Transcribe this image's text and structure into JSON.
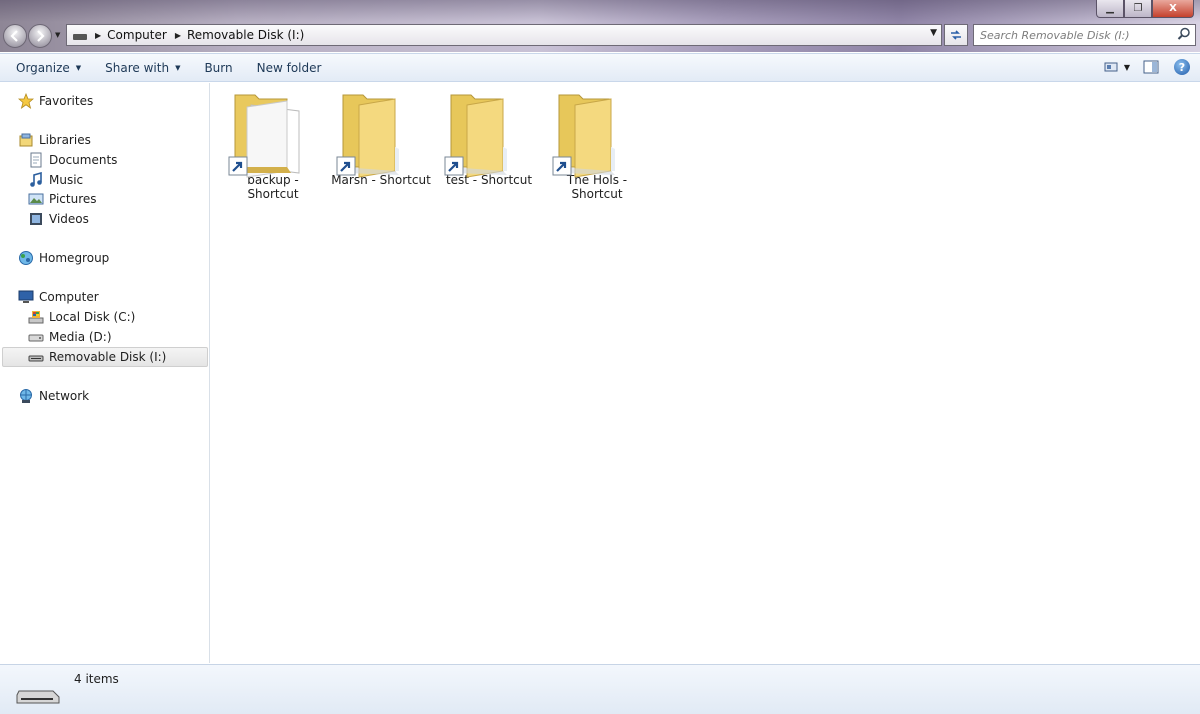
{
  "window": {
    "minimize_glyph": "▁",
    "maximize_glyph": "❐",
    "close_glyph": "X"
  },
  "address_bar": {
    "breadcrumbs": [
      "Computer",
      "Removable Disk (I:)"
    ],
    "search_placeholder": "Search Removable Disk (I:)"
  },
  "toolbar": {
    "organize_label": "Organize",
    "share_label": "Share with",
    "burn_label": "Burn",
    "new_folder_label": "New folder"
  },
  "sidebar": {
    "favorites": "Favorites",
    "libraries": "Libraries",
    "library_items": [
      "Documents",
      "Music",
      "Pictures",
      "Videos"
    ],
    "homegroup": "Homegroup",
    "computer": "Computer",
    "computer_items": [
      "Local Disk (C:)",
      "Media (D:)",
      "Removable Disk (I:)"
    ],
    "selected": "Removable Disk (I:)",
    "network": "Network"
  },
  "files": [
    {
      "line1": "backup -",
      "line2": "Shortcut",
      "icon": "folder-with-documents-shortcut-icon"
    },
    {
      "line1": "Marsh - Shortcut",
      "line2": "",
      "icon": "folder-shortcut-icon"
    },
    {
      "line1": "test - Shortcut",
      "line2": "",
      "icon": "folder-shortcut-icon"
    },
    {
      "line1": "The Hols -",
      "line2": "Shortcut",
      "icon": "folder-shortcut-icon"
    }
  ],
  "status": {
    "item_count": "4 items"
  },
  "colors": {
    "folder": "#f2d779",
    "shortcut_arrow": "#1f4f8f",
    "selection": "#e5e5e5"
  }
}
